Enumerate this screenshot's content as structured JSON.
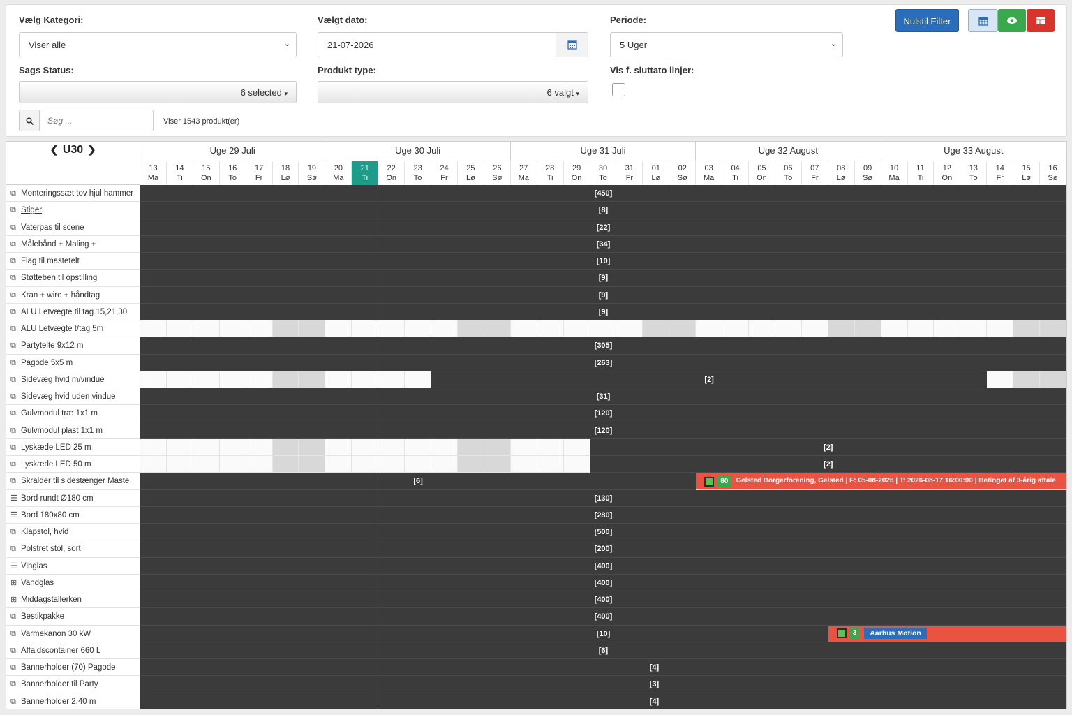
{
  "filter": {
    "kategori_label": "Vælg Kategori:",
    "kategori_value": "Viser alle",
    "dato_label": "Vælgt dato:",
    "dato_value": "21-07-2026",
    "periode_label": "Periode:",
    "periode_value": "5 Uger",
    "status_label": "Sags Status:",
    "status_value": "6 selected",
    "produkt_label": "Produkt type:",
    "produkt_value": "6 valgt",
    "sluttato_label": "Vis f. sluttato linjer:",
    "reset_label": "Nulstil Filter",
    "search_placeholder": "Søg ...",
    "count_text": "Viser 1543 produkt(er)"
  },
  "nav": {
    "week_label": "U30",
    "prev": "❮",
    "next": "❯"
  },
  "weeks": [
    {
      "label": "Uge 29 Juli",
      "days": 7
    },
    {
      "label": "Uge 30 Juli",
      "days": 7
    },
    {
      "label": "Uge 31 Juli",
      "days": 7
    },
    {
      "label": "Uge 32 August",
      "days": 7
    },
    {
      "label": "Uge 33 August",
      "days": 7
    }
  ],
  "days": [
    {
      "n": "13",
      "d": "Ma"
    },
    {
      "n": "14",
      "d": "Ti"
    },
    {
      "n": "15",
      "d": "On"
    },
    {
      "n": "16",
      "d": "To"
    },
    {
      "n": "17",
      "d": "Fr"
    },
    {
      "n": "18",
      "d": "Lø"
    },
    {
      "n": "19",
      "d": "Sø"
    },
    {
      "n": "20",
      "d": "Ma"
    },
    {
      "n": "21",
      "d": "Ti"
    },
    {
      "n": "22",
      "d": "On"
    },
    {
      "n": "23",
      "d": "To"
    },
    {
      "n": "24",
      "d": "Fr"
    },
    {
      "n": "25",
      "d": "Lø"
    },
    {
      "n": "26",
      "d": "Sø"
    },
    {
      "n": "27",
      "d": "Ma"
    },
    {
      "n": "28",
      "d": "Ti"
    },
    {
      "n": "29",
      "d": "On"
    },
    {
      "n": "30",
      "d": "To"
    },
    {
      "n": "31",
      "d": "Fr"
    },
    {
      "n": "01",
      "d": "Lø"
    },
    {
      "n": "02",
      "d": "Sø"
    },
    {
      "n": "03",
      "d": "Ma"
    },
    {
      "n": "04",
      "d": "Ti"
    },
    {
      "n": "05",
      "d": "On"
    },
    {
      "n": "06",
      "d": "To"
    },
    {
      "n": "07",
      "d": "Fr"
    },
    {
      "n": "08",
      "d": "Lø"
    },
    {
      "n": "09",
      "d": "Sø"
    },
    {
      "n": "10",
      "d": "Ma"
    },
    {
      "n": "11",
      "d": "Ti"
    },
    {
      "n": "12",
      "d": "On"
    },
    {
      "n": "13",
      "d": "To"
    },
    {
      "n": "14",
      "d": "Fr"
    },
    {
      "n": "15",
      "d": "Lø"
    },
    {
      "n": "16",
      "d": "Sø"
    }
  ],
  "today_index": 8,
  "rows": [
    {
      "name": "Monteringssæt tov hjul hammer",
      "icon": "copy-icon",
      "bars": [
        {
          "from": 0,
          "to": 35,
          "label": "[450]"
        }
      ]
    },
    {
      "name": "Stiger",
      "icon": "copy-icon",
      "link": true,
      "bars": [
        {
          "from": 0,
          "to": 35,
          "label": "[8]"
        }
      ]
    },
    {
      "name": "Vaterpas til scene",
      "icon": "copy-icon",
      "bars": [
        {
          "from": 0,
          "to": 35,
          "label": "[22]"
        }
      ]
    },
    {
      "name": "Målebånd + Maling +",
      "icon": "copy-icon",
      "bars": [
        {
          "from": 0,
          "to": 35,
          "label": "[34]"
        }
      ]
    },
    {
      "name": "Flag til mastetelt",
      "icon": "copy-icon",
      "bars": [
        {
          "from": 0,
          "to": 35,
          "label": "[10]"
        }
      ]
    },
    {
      "name": "Støtteben til opstilling",
      "icon": "copy-icon",
      "bars": [
        {
          "from": 0,
          "to": 35,
          "label": "[9]"
        }
      ]
    },
    {
      "name": "Kran + wire + håndtag",
      "icon": "copy-icon",
      "bars": [
        {
          "from": 0,
          "to": 35,
          "label": "[9]"
        }
      ]
    },
    {
      "name": "ALU Letvægte til tag 15,21,30",
      "icon": "copy-icon",
      "bars": [
        {
          "from": 0,
          "to": 35,
          "label": "[9]"
        }
      ]
    },
    {
      "name": "ALU Letvægte t/tag 5m",
      "icon": "copy-icon",
      "bars": []
    },
    {
      "name": "Partytelte 9x12 m",
      "icon": "copy-icon",
      "bars": [
        {
          "from": 0,
          "to": 35,
          "label": "[305]"
        }
      ]
    },
    {
      "name": "Pagode 5x5 m",
      "icon": "copy-icon",
      "bars": [
        {
          "from": 0,
          "to": 35,
          "label": "[263]"
        }
      ]
    },
    {
      "name": "Sidevæg hvid m/vindue",
      "icon": "copy-icon",
      "bars": [
        {
          "from": 11,
          "to": 32,
          "label": "[2]"
        }
      ]
    },
    {
      "name": "Sidevæg hvid uden vindue",
      "icon": "copy-icon",
      "bars": [
        {
          "from": 0,
          "to": 35,
          "label": "[31]"
        }
      ]
    },
    {
      "name": "Gulvmodul træ 1x1 m",
      "icon": "copy-icon",
      "bars": [
        {
          "from": 0,
          "to": 35,
          "label": "[120]"
        }
      ]
    },
    {
      "name": "Gulvmodul plast 1x1 m",
      "icon": "copy-icon",
      "bars": [
        {
          "from": 0,
          "to": 35,
          "label": "[120]"
        }
      ]
    },
    {
      "name": "Lyskæde LED 25 m",
      "icon": "copy-icon",
      "bars": [
        {
          "from": 17,
          "to": 35,
          "label": "[2]"
        }
      ]
    },
    {
      "name": "Lyskæde LED 50 m",
      "icon": "copy-icon",
      "bars": [
        {
          "from": 17,
          "to": 35,
          "label": "[2]"
        }
      ]
    },
    {
      "name": "Skralder til sidestænger Maste",
      "icon": "copy-icon",
      "bars": [
        {
          "from": 0,
          "to": 21,
          "label": "[6]"
        }
      ],
      "event": {
        "from": 21,
        "to": 35,
        "count": "80",
        "text": "Gelsted Borgerforening, Gelsted | F: 05-08-2026 | T: 2026-08-17 16:00:00 | Betinget af 3-årig aftale"
      }
    },
    {
      "name": "Bord rundt Ø180 cm",
      "icon": "list-icon",
      "bars": [
        {
          "from": 0,
          "to": 35,
          "label": "[130]"
        }
      ]
    },
    {
      "name": "Bord 180x80 cm",
      "icon": "list-icon",
      "bars": [
        {
          "from": 0,
          "to": 35,
          "label": "[280]"
        }
      ]
    },
    {
      "name": "Klapstol, hvid",
      "icon": "copy-icon",
      "bars": [
        {
          "from": 0,
          "to": 35,
          "label": "[500]"
        }
      ]
    },
    {
      "name": "Polstret stol, sort",
      "icon": "copy-icon",
      "bars": [
        {
          "from": 0,
          "to": 35,
          "label": "[200]"
        }
      ]
    },
    {
      "name": "Vinglas",
      "icon": "list-icon",
      "bars": [
        {
          "from": 0,
          "to": 35,
          "label": "[400]"
        }
      ]
    },
    {
      "name": "Vandglas",
      "icon": "table-icon",
      "bars": [
        {
          "from": 0,
          "to": 35,
          "label": "[400]"
        }
      ]
    },
    {
      "name": "Middagstallerken",
      "icon": "table-icon",
      "bars": [
        {
          "from": 0,
          "to": 35,
          "label": "[400]"
        }
      ]
    },
    {
      "name": "Bestikpakke",
      "icon": "copy-icon",
      "bars": [
        {
          "from": 0,
          "to": 35,
          "label": "[400]"
        }
      ]
    },
    {
      "name": "Varmekanon 30 kW",
      "icon": "copy-icon",
      "bars": [
        {
          "from": 0,
          "to": 35,
          "label": "[10]"
        }
      ],
      "event": {
        "from": 26,
        "to": 35,
        "count": "3",
        "tag": "Aarhus Motion"
      }
    },
    {
      "name": "Affaldscontainer 660 L",
      "icon": "copy-icon",
      "bars": [
        {
          "from": 0,
          "to": 35,
          "label": "[6]"
        }
      ]
    },
    {
      "name": "Bannerholder (70) Pagode",
      "icon": "copy-icon",
      "bars": [
        {
          "from": 0,
          "to": 35,
          "label": "[4]"
        }
      ],
      "labelShift": true
    },
    {
      "name": "Bannerholder til Party",
      "icon": "copy-icon",
      "bars": [
        {
          "from": 0,
          "to": 35,
          "label": "[3]"
        }
      ],
      "labelShift": true
    },
    {
      "name": "Bannerholder 2,40 m",
      "icon": "copy-icon",
      "bars": [
        {
          "from": 0,
          "to": 35,
          "label": "[4]"
        }
      ],
      "labelShift": true
    }
  ],
  "colors": {
    "bar": "#3b3b3b",
    "today": "#1e9c8a",
    "event": "#ea5242",
    "primary": "#2a6ebb",
    "success": "#3aa84c",
    "danger": "#d9342b"
  }
}
